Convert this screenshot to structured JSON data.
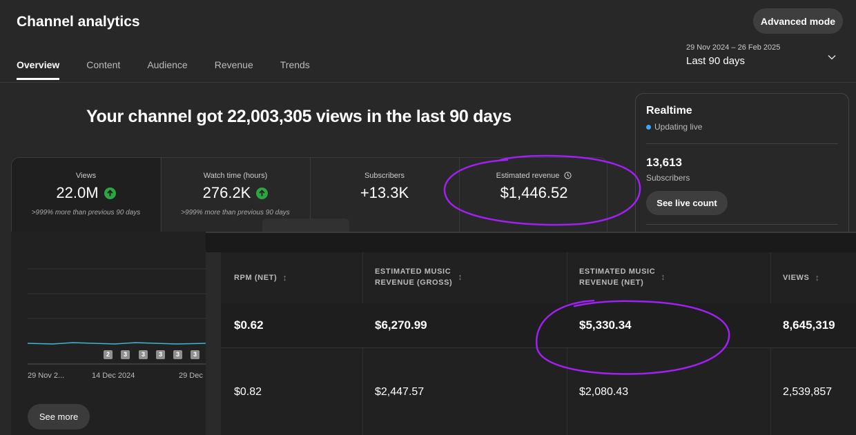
{
  "header": {
    "title": "Channel analytics",
    "advanced_mode_label": "Advanced mode"
  },
  "tabs": [
    {
      "label": "Overview",
      "active": true
    },
    {
      "label": "Content"
    },
    {
      "label": "Audience"
    },
    {
      "label": "Revenue"
    },
    {
      "label": "Trends"
    }
  ],
  "date_range": {
    "dates": "29 Nov 2024 – 26 Feb 2025",
    "label": "Last 90 days"
  },
  "headline": "Your channel got 22,003,305 views in the last 90 days",
  "metrics": [
    {
      "label": "Views",
      "value": "22.0M",
      "note": ">999% more than previous 90 days",
      "trend": "up"
    },
    {
      "label": "Watch time (hours)",
      "value": "276.2K",
      "note": ">999% more than previous 90 days",
      "trend": "up"
    },
    {
      "label": "Subscribers",
      "value": "+13.3K"
    },
    {
      "label": "Estimated revenue",
      "value": "$1,446.52"
    }
  ],
  "realtime": {
    "title": "Realtime",
    "status": "Updating live",
    "subscribers_value": "13,613",
    "subscribers_label": "Subscribers",
    "button_label": "See live count"
  },
  "chart": {
    "x_ticks": [
      "29 Nov 2...",
      "14 Dec 2024",
      "29 Dec"
    ],
    "markers": [
      "2",
      "3",
      "3",
      "3",
      "3",
      "3"
    ],
    "line_color": "#41b4d2",
    "see_more_label": "See more"
  },
  "table": {
    "columns": [
      {
        "line1": "RPM (NET)",
        "line2": ""
      },
      {
        "line1": "ESTIMATED MUSIC",
        "line2": "REVENUE (GROSS)"
      },
      {
        "line1": "ESTIMATED MUSIC",
        "line2": "REVENUE (NET)"
      },
      {
        "line1": "VIEWS",
        "line2": ""
      }
    ],
    "rows": [
      [
        "$0.62",
        "$6,270.99",
        "$5,330.34",
        "8,645,319"
      ],
      [
        "$0.82",
        "$2,447.57",
        "$2,080.43",
        "2,539,857"
      ]
    ]
  },
  "colors": {
    "background": "#282828",
    "trend_up": "#2ba640",
    "live_dot": "#3ea6ff",
    "annotation": "#a020f0"
  }
}
